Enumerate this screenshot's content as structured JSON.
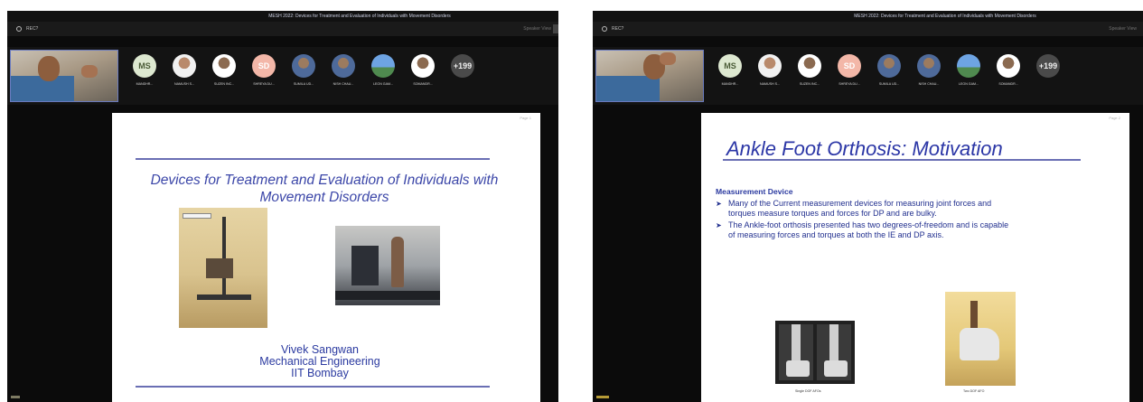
{
  "meeting": {
    "title": "MESH 2022: Devices for Treatment and Evaluation of Individuals with Movement Disorders",
    "record_label": "REC?",
    "view_label": "Speaker View"
  },
  "participants": [
    {
      "initials": "MS",
      "name": "MANDHR...",
      "style": "initials-ms"
    },
    {
      "initials": "",
      "name": "NAMUSH S...",
      "style": "photo"
    },
    {
      "initials": "",
      "name": "SUZEN INC...",
      "style": "photo2"
    },
    {
      "initials": "SD",
      "name": "SHREYA DU...",
      "style": "initials-sd"
    },
    {
      "initials": "",
      "name": "SUMILA UD...",
      "style": "photo3"
    },
    {
      "initials": "",
      "name": "NISH CHAU...",
      "style": "photo3"
    },
    {
      "initials": "",
      "name": "LEON GAM...",
      "style": "sky"
    },
    {
      "initials": "",
      "name": "SOMANDR...",
      "style": "photo2"
    }
  ],
  "more_label": "+199",
  "slide_left": {
    "page_no": "Page 1",
    "title": "Devices for Treatment and Evaluation of Individuals with Movement Disorders",
    "author_name": "Vivek Sangwan",
    "author_dept": "Mechanical Engineering",
    "author_inst": "IIT Bombay"
  },
  "slide_right": {
    "page_no": "Page 2",
    "title": "Ankle Foot Orthosis: Motivation",
    "section": "Measurement Device",
    "bullets": [
      "Many of the Current measurement devices for measuring joint forces and torques measure torques and forces for DP and are bulky.",
      "The Ankle-foot orthosis presented has two degrees-of-freedom and is capable of measuring forces and torques at both the IE and DP axis."
    ],
    "caption_left": "Single DOF AFOs",
    "caption_right": "Two DOF AFO"
  }
}
